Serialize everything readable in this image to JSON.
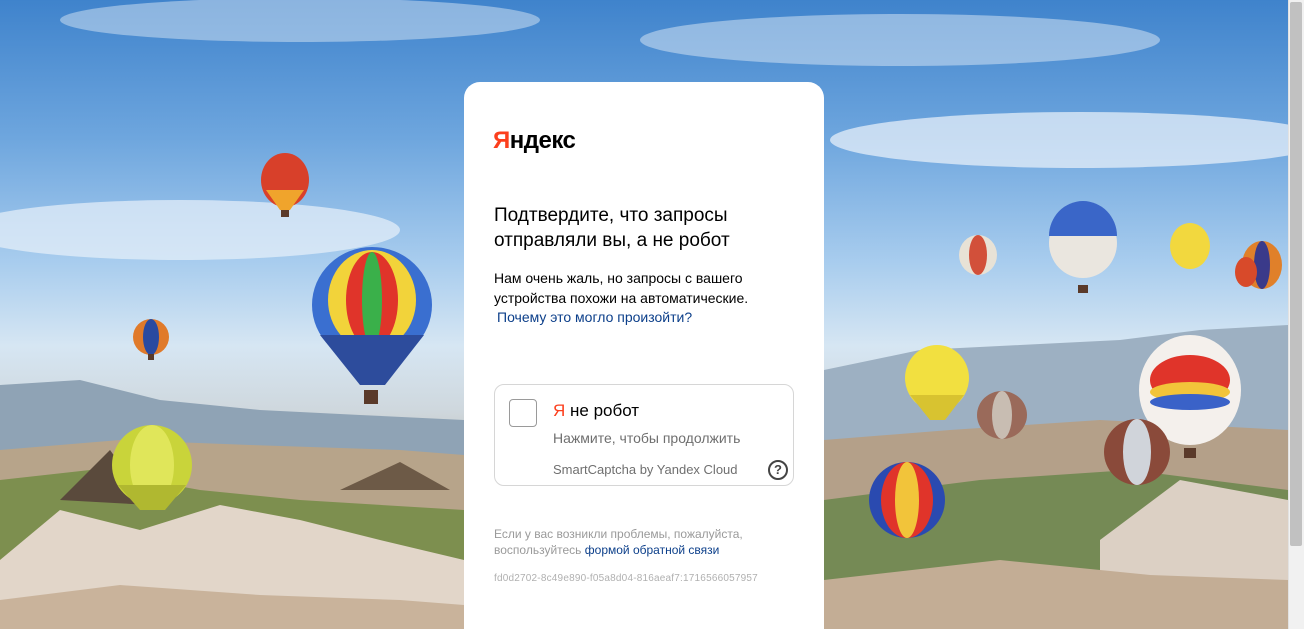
{
  "logo": {
    "first": "Я",
    "rest": "ндекс"
  },
  "title": "Подтвердите, что запросы отправляли вы, а не робот",
  "description": "Нам очень жаль, но запросы с вашего устройства похожи на автоматические.",
  "why_link": "Почему это могло произойти?",
  "captcha": {
    "title_prefix": "Я",
    "title_rest": " не робот",
    "hint": "Нажмите, чтобы продолжить",
    "brand": "SmartCaptcha by Yandex Cloud",
    "help_symbol": "?"
  },
  "footer": {
    "text": "Если у вас возникли проблемы, пожалуйста, воспользуйтесь ",
    "link": "формой обратной связи"
  },
  "request_id": "fd0d2702-8c49e890-f05a8d04-816aeaf7:1716566057957",
  "colors": {
    "accent": "#fc3f1d",
    "link": "#0c3f8a"
  }
}
